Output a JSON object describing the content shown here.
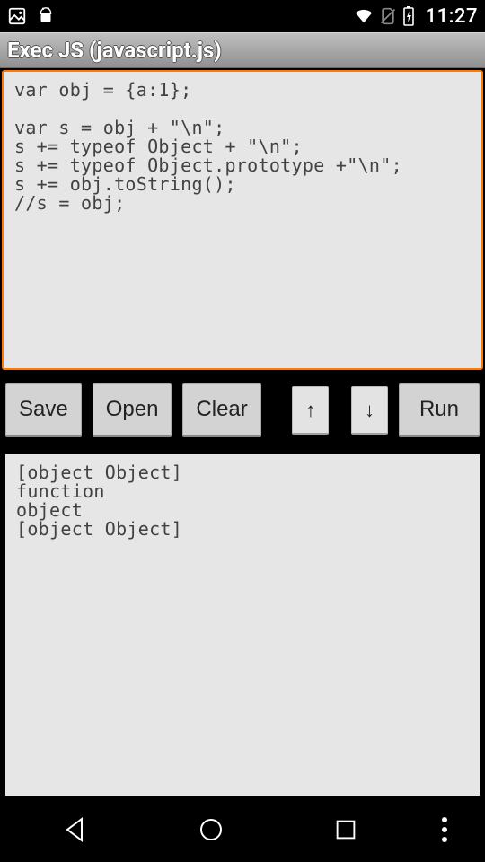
{
  "status": {
    "time": "11:27"
  },
  "title": "Exec JS (javascript.js)",
  "editor": {
    "code": "var obj = {a:1};\n\nvar s = obj + \"\\n\";\ns += typeof Object + \"\\n\";\ns += typeof Object.prototype +\"\\n\";\ns += obj.toString();\n//s = obj;"
  },
  "toolbar": {
    "save": "Save",
    "open": "Open",
    "clear": "Clear",
    "up": "↑",
    "down": "↓",
    "run": "Run"
  },
  "output": {
    "text": "[object Object]\nfunction\nobject\n[object Object]"
  }
}
